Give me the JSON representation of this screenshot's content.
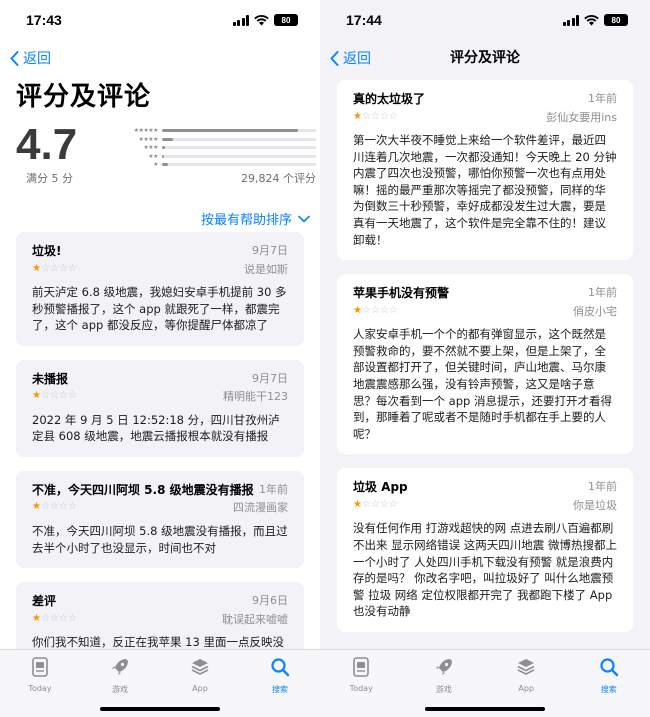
{
  "left": {
    "status": {
      "time": "17:43",
      "battery": "80"
    },
    "back_label": "返回",
    "title": "评分及评论",
    "rating": {
      "score": "4.7",
      "out_of": "满分 5 分",
      "count": "29,824 个评分",
      "distribution": [
        0.88,
        0.07,
        0.02,
        0.01,
        0.04
      ]
    },
    "sort_label": "按最有帮助排序",
    "reviews": [
      {
        "title": "垃圾!",
        "date": "9月7日",
        "author": "说是如斯",
        "stars": 1,
        "body": "前天泸定 6.8 级地震，我媳妇安卓手机提前 30 多秒预警播报了，这个 app 就跟死了一样，都震完了，这个 app 都没反应，等你提醒尸体都凉了"
      },
      {
        "title": "未播报",
        "date": "9月7日",
        "author": "精明能干123",
        "stars": 1,
        "body": "2022 年 9 月 5 日 12:52:18 分，四川甘孜州泸定县 608 级地震，地震云播报根本就没有播报"
      },
      {
        "title": "不准，今天四川阿坝 5.8 级地震没有播报",
        "date": "1年前",
        "author": "四流漫画家",
        "stars": 1,
        "body": "不准，今天四川阿坝 5.8 级地震没有播报，而且过去半个小时了也没显示，时间也不对"
      },
      {
        "title": "差评",
        "date": "9月6日",
        "author": "耽误起来嘘嘘",
        "stars": 1,
        "body": "你们我不知道，反正在我苹果 13 里面一点反映没"
      }
    ]
  },
  "right": {
    "status": {
      "time": "17:44",
      "battery": "80"
    },
    "back_label": "返回",
    "nav_title": "评分及评论",
    "reviews": [
      {
        "title": "真的太垃圾了",
        "date": "1年前",
        "author": "彭仙女要用ins",
        "stars": 1,
        "body": "第一次大半夜不睡觉上来给一个软件差评，最近四川连着几次地震，一次都没通知！今天晚上 20 分钟内震了四次也没预警，哪怕你预警一次也有点用处嘛！摇的最严重那次等摇完了都没预警，同样的华为倒数三十秒预警，幸好成都没发生过大震，要是真有一天地震了，这个软件是完全靠不住的！建议卸载！"
      },
      {
        "title": "苹果手机没有预警",
        "date": "1年前",
        "author": "俏皮小宅",
        "stars": 1,
        "body": "人家安卓手机一个个的都有弹窗显示，这个既然是预警救命的，要不然就不要上架，但是上架了，全部设置都打开了，但关键时间，庐山地震、马尔康地震震感那么强，没有铃声预警，这又是啥子意思？每次看到一个 app 消息提示，还要打开才看得到，那睡着了呢或者不是随时手机都在手上要的人呢？"
      },
      {
        "title": "垃圾 App",
        "date": "1年前",
        "author": "你是垃圾",
        "stars": 1,
        "body": "没有任何作用 打游戏超快的网 点进去刷八百遍都刷不出来 显示网络错误 这两天四川地震 微博热搜都上一个小时了 人处四川手机下载没有预警 就是浪费内存的是吗？ 你改名字吧，叫拉圾好了 叫什么地震预警 拉圾 网络 定位权限都开完了 我都跑下楼了 App也没有动静"
      }
    ]
  },
  "tabs": [
    {
      "label": "Today",
      "icon": "today-icon"
    },
    {
      "label": "游戏",
      "icon": "rocket-icon"
    },
    {
      "label": "App",
      "icon": "apps-stack-icon"
    },
    {
      "label": "搜索",
      "icon": "search-icon",
      "active": true
    }
  ],
  "colors": {
    "accent": "#0a84ff",
    "star": "#ff9500"
  }
}
